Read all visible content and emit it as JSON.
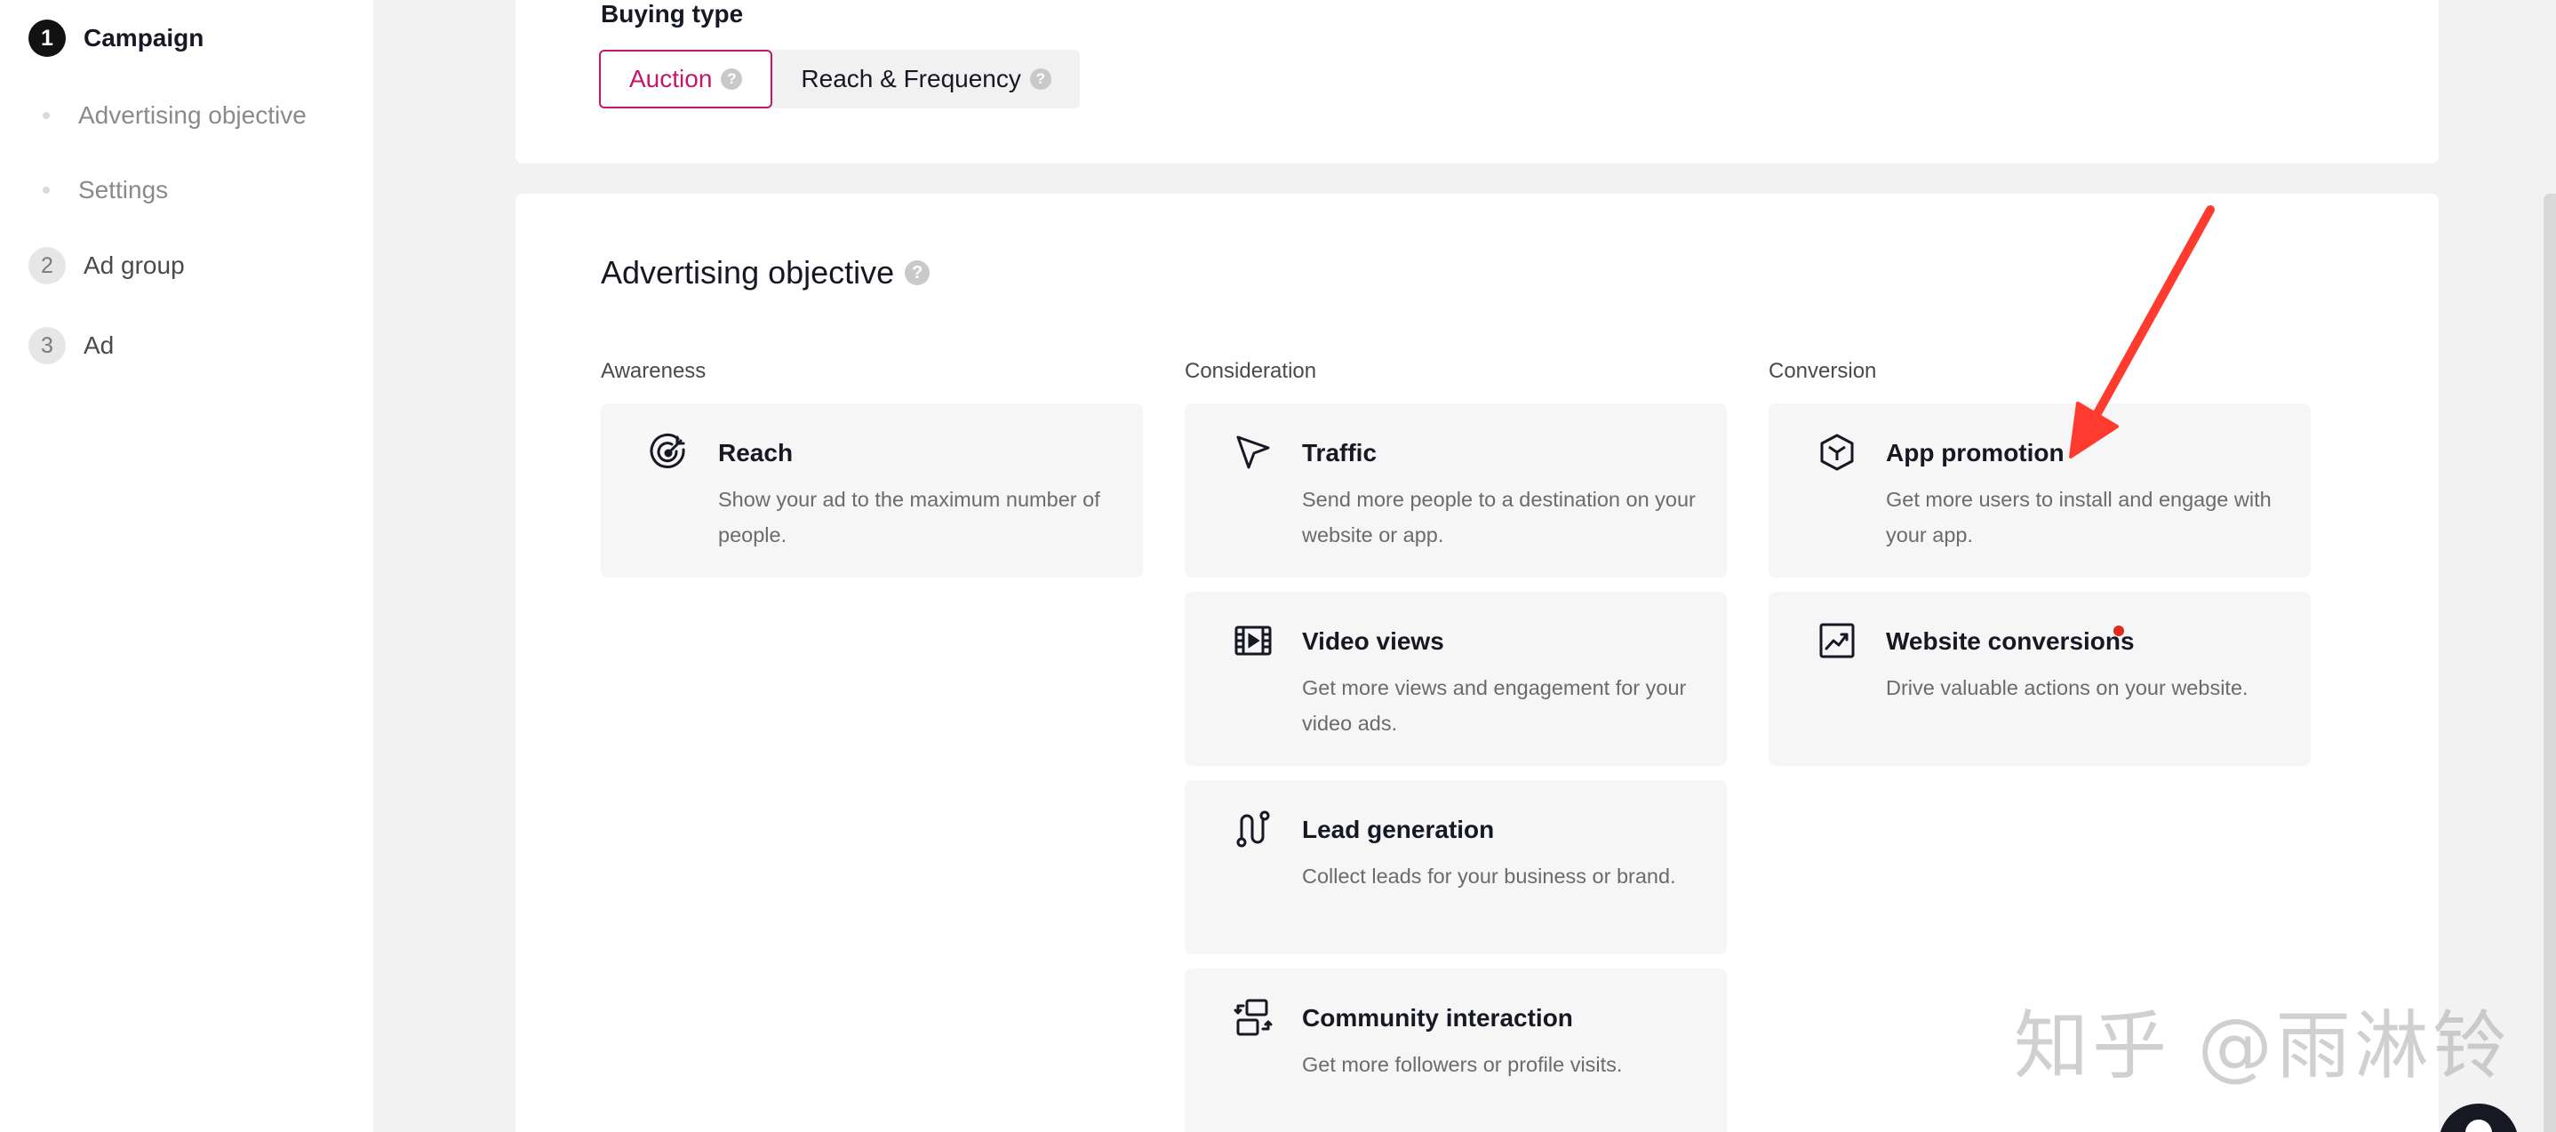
{
  "sidebar": {
    "steps": [
      {
        "num": "1",
        "label": "Campaign"
      },
      {
        "num": "2",
        "label": "Ad group"
      },
      {
        "num": "3",
        "label": "Ad"
      }
    ],
    "substeps": [
      "Advertising objective",
      "Settings"
    ]
  },
  "buying": {
    "title": "Buying type",
    "options": [
      "Auction",
      "Reach & Frequency"
    ],
    "selected": "Auction",
    "help_glyph": "?"
  },
  "objective": {
    "title": "Advertising objective",
    "help_glyph": "?",
    "columns": [
      "Awareness",
      "Consideration",
      "Conversion"
    ],
    "cards": {
      "reach": {
        "icon": "target-icon",
        "title": "Reach",
        "desc": "Show your ad to the maximum number of people."
      },
      "traffic": {
        "icon": "cursor-arrow-icon",
        "title": "Traffic",
        "desc": "Send more people to a destination on your website or app."
      },
      "video_views": {
        "icon": "film-icon",
        "title": "Video views",
        "desc": "Get more views and engagement for your video ads."
      },
      "lead_generation": {
        "icon": "funnel-path-icon",
        "title": "Lead generation",
        "desc": "Collect leads for your business or brand."
      },
      "community_interaction": {
        "icon": "swap-squares-icon",
        "title": "Community interaction",
        "desc": "Get more followers or profile visits."
      },
      "app_promotion": {
        "icon": "cube-icon",
        "title": "App promotion",
        "desc": "Get more users to install and engage with your app."
      },
      "website_conversions": {
        "icon": "trend-chart-icon",
        "title": "Website conversions",
        "desc": "Drive valuable actions on your website."
      }
    }
  },
  "annotation": {
    "arrow_color": "#ff3b2f",
    "watermark": "知乎 @雨淋铃"
  },
  "colors": {
    "accent": "#c4166a",
    "new_dot": "#e02a1b"
  }
}
